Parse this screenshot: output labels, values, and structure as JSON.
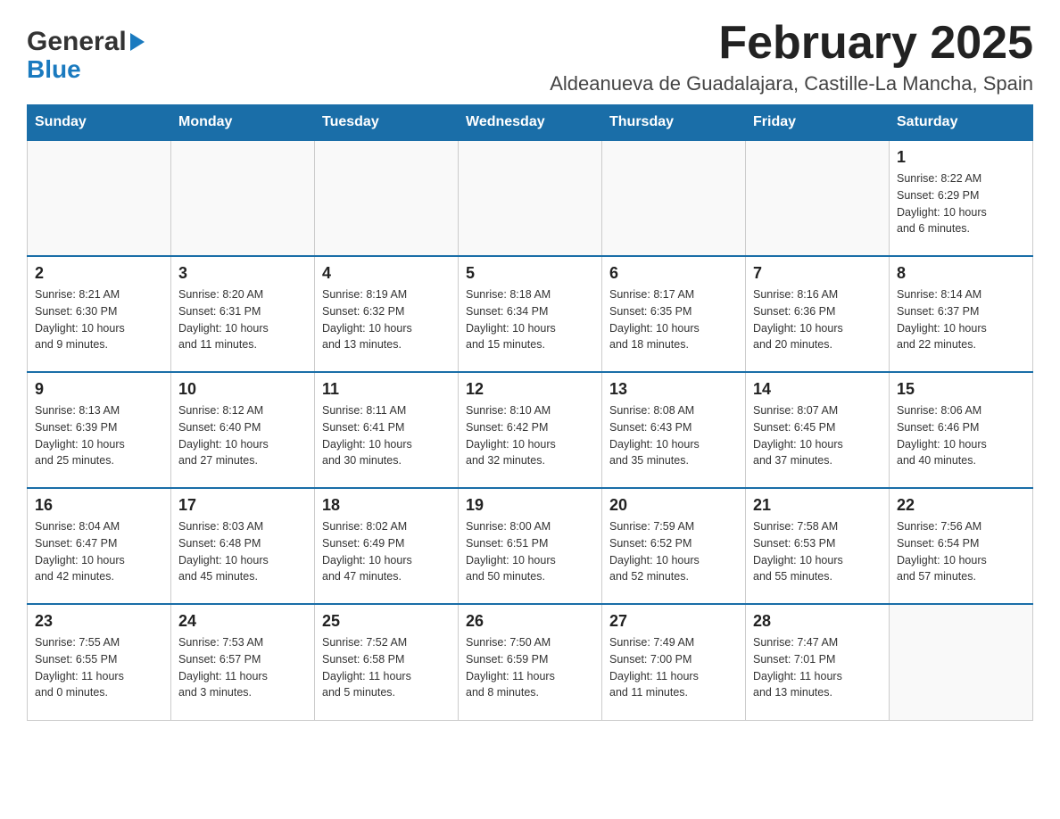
{
  "header": {
    "logo_general": "General",
    "logo_blue": "Blue",
    "month_title": "February 2025",
    "location": "Aldeanueva de Guadalajara, Castille-La Mancha, Spain"
  },
  "weekdays": [
    "Sunday",
    "Monday",
    "Tuesday",
    "Wednesday",
    "Thursday",
    "Friday",
    "Saturday"
  ],
  "weeks": [
    [
      {
        "day": "",
        "info": ""
      },
      {
        "day": "",
        "info": ""
      },
      {
        "day": "",
        "info": ""
      },
      {
        "day": "",
        "info": ""
      },
      {
        "day": "",
        "info": ""
      },
      {
        "day": "",
        "info": ""
      },
      {
        "day": "1",
        "info": "Sunrise: 8:22 AM\nSunset: 6:29 PM\nDaylight: 10 hours\nand 6 minutes."
      }
    ],
    [
      {
        "day": "2",
        "info": "Sunrise: 8:21 AM\nSunset: 6:30 PM\nDaylight: 10 hours\nand 9 minutes."
      },
      {
        "day": "3",
        "info": "Sunrise: 8:20 AM\nSunset: 6:31 PM\nDaylight: 10 hours\nand 11 minutes."
      },
      {
        "day": "4",
        "info": "Sunrise: 8:19 AM\nSunset: 6:32 PM\nDaylight: 10 hours\nand 13 minutes."
      },
      {
        "day": "5",
        "info": "Sunrise: 8:18 AM\nSunset: 6:34 PM\nDaylight: 10 hours\nand 15 minutes."
      },
      {
        "day": "6",
        "info": "Sunrise: 8:17 AM\nSunset: 6:35 PM\nDaylight: 10 hours\nand 18 minutes."
      },
      {
        "day": "7",
        "info": "Sunrise: 8:16 AM\nSunset: 6:36 PM\nDaylight: 10 hours\nand 20 minutes."
      },
      {
        "day": "8",
        "info": "Sunrise: 8:14 AM\nSunset: 6:37 PM\nDaylight: 10 hours\nand 22 minutes."
      }
    ],
    [
      {
        "day": "9",
        "info": "Sunrise: 8:13 AM\nSunset: 6:39 PM\nDaylight: 10 hours\nand 25 minutes."
      },
      {
        "day": "10",
        "info": "Sunrise: 8:12 AM\nSunset: 6:40 PM\nDaylight: 10 hours\nand 27 minutes."
      },
      {
        "day": "11",
        "info": "Sunrise: 8:11 AM\nSunset: 6:41 PM\nDaylight: 10 hours\nand 30 minutes."
      },
      {
        "day": "12",
        "info": "Sunrise: 8:10 AM\nSunset: 6:42 PM\nDaylight: 10 hours\nand 32 minutes."
      },
      {
        "day": "13",
        "info": "Sunrise: 8:08 AM\nSunset: 6:43 PM\nDaylight: 10 hours\nand 35 minutes."
      },
      {
        "day": "14",
        "info": "Sunrise: 8:07 AM\nSunset: 6:45 PM\nDaylight: 10 hours\nand 37 minutes."
      },
      {
        "day": "15",
        "info": "Sunrise: 8:06 AM\nSunset: 6:46 PM\nDaylight: 10 hours\nand 40 minutes."
      }
    ],
    [
      {
        "day": "16",
        "info": "Sunrise: 8:04 AM\nSunset: 6:47 PM\nDaylight: 10 hours\nand 42 minutes."
      },
      {
        "day": "17",
        "info": "Sunrise: 8:03 AM\nSunset: 6:48 PM\nDaylight: 10 hours\nand 45 minutes."
      },
      {
        "day": "18",
        "info": "Sunrise: 8:02 AM\nSunset: 6:49 PM\nDaylight: 10 hours\nand 47 minutes."
      },
      {
        "day": "19",
        "info": "Sunrise: 8:00 AM\nSunset: 6:51 PM\nDaylight: 10 hours\nand 50 minutes."
      },
      {
        "day": "20",
        "info": "Sunrise: 7:59 AM\nSunset: 6:52 PM\nDaylight: 10 hours\nand 52 minutes."
      },
      {
        "day": "21",
        "info": "Sunrise: 7:58 AM\nSunset: 6:53 PM\nDaylight: 10 hours\nand 55 minutes."
      },
      {
        "day": "22",
        "info": "Sunrise: 7:56 AM\nSunset: 6:54 PM\nDaylight: 10 hours\nand 57 minutes."
      }
    ],
    [
      {
        "day": "23",
        "info": "Sunrise: 7:55 AM\nSunset: 6:55 PM\nDaylight: 11 hours\nand 0 minutes."
      },
      {
        "day": "24",
        "info": "Sunrise: 7:53 AM\nSunset: 6:57 PM\nDaylight: 11 hours\nand 3 minutes."
      },
      {
        "day": "25",
        "info": "Sunrise: 7:52 AM\nSunset: 6:58 PM\nDaylight: 11 hours\nand 5 minutes."
      },
      {
        "day": "26",
        "info": "Sunrise: 7:50 AM\nSunset: 6:59 PM\nDaylight: 11 hours\nand 8 minutes."
      },
      {
        "day": "27",
        "info": "Sunrise: 7:49 AM\nSunset: 7:00 PM\nDaylight: 11 hours\nand 11 minutes."
      },
      {
        "day": "28",
        "info": "Sunrise: 7:47 AM\nSunset: 7:01 PM\nDaylight: 11 hours\nand 13 minutes."
      },
      {
        "day": "",
        "info": ""
      }
    ]
  ]
}
